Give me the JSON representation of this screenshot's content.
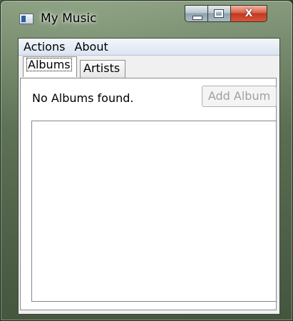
{
  "window": {
    "title": "My Music",
    "caption": {
      "minimize_icon": "minimize-icon",
      "maximize_icon": "maximize-icon",
      "close_icon": "close-icon",
      "close_glyph": "X"
    }
  },
  "menu": {
    "items": [
      {
        "label": "Actions"
      },
      {
        "label": "About"
      }
    ]
  },
  "tabs": [
    {
      "label": "Albums",
      "selected": true
    },
    {
      "label": "Artists",
      "selected": false
    }
  ],
  "albums_panel": {
    "status_text": "No Albums found.",
    "add_button_label": "Add Album",
    "add_button_enabled": false,
    "list_items": []
  },
  "colors": {
    "client_bg": "#f0f0f0",
    "menubar_bg": "#dbe4f1",
    "disabled_text": "#a0a0a0",
    "close_button": "#c13a1f"
  }
}
